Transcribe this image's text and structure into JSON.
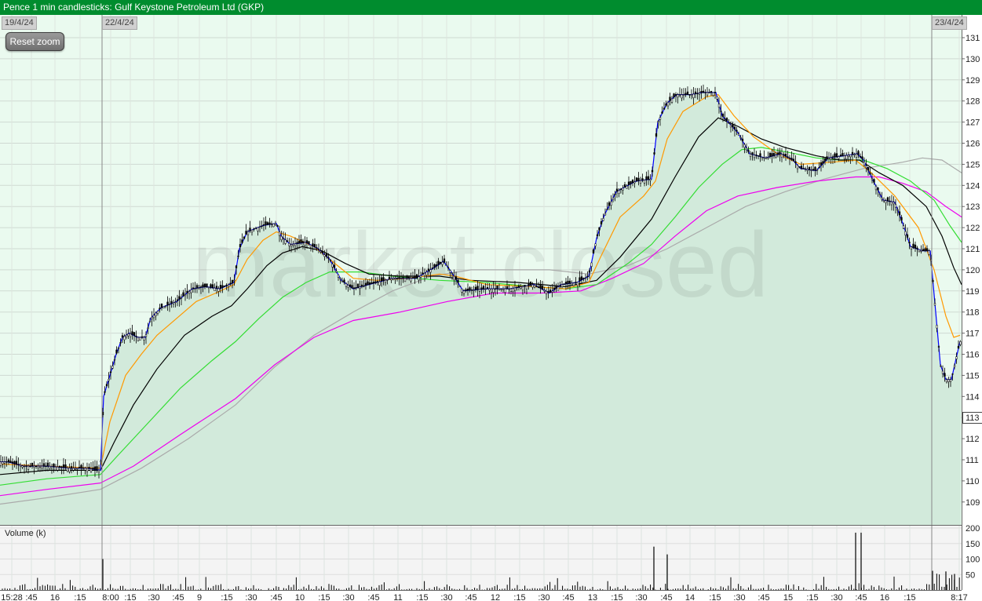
{
  "title": "Pence 1 min candlesticks: Gulf Keystone Petroleum Ltd (GKP)",
  "reset_zoom_label": "Reset zoom",
  "watermark": "market closed",
  "date_flags": [
    "19/4/24",
    "22/4/24",
    "23/4/24"
  ],
  "volume_label": "Volume (k)",
  "last_price_label": "113",
  "colors": {
    "title_bar": "#008c2e",
    "plot_bg": "#eafaef",
    "area_fill": "#d2eadb",
    "candles": "#000000",
    "ma_fast": "#0000ff",
    "ma_orange": "#ff9900",
    "ma_black": "#000000",
    "ma_green": "#33dd33",
    "ma_magenta": "#ee00ee",
    "ma_grey": "#aaaaaa"
  },
  "chart_data": {
    "type": "line",
    "title": "Pence 1 min candlesticks: Gulf Keystone Petroleum Ltd (GKP)",
    "y_axis": {
      "ticks": [
        109,
        110,
        111,
        112,
        113,
        114,
        115,
        116,
        117,
        118,
        119,
        120,
        121,
        122,
        123,
        124,
        125,
        126,
        127,
        128,
        129,
        130,
        131
      ],
      "range": [
        108.2,
        131.3
      ]
    },
    "volume_axis": {
      "ticks": [
        50,
        100,
        150,
        200
      ],
      "range": [
        0,
        210
      ]
    },
    "x_ticks": [
      "15:28",
      ":45",
      "16",
      ":15",
      "8:00",
      ":15",
      ":30",
      ":45",
      "9",
      ":15",
      ":30",
      ":45",
      "10",
      ":15",
      ":30",
      ":45",
      "11",
      ":15",
      ":30",
      ":45",
      "12",
      ":15",
      ":30",
      ":45",
      "13",
      ":15",
      ":30",
      ":45",
      "14",
      ":15",
      ":30",
      ":45",
      "15",
      ":15",
      ":30",
      ":45",
      "16",
      ":15",
      "8:17"
    ],
    "series": [
      {
        "name": "price",
        "color": "#0000ff",
        "points": [
          [
            0,
            110.9
          ],
          [
            10,
            110.9
          ],
          [
            30,
            110.7
          ],
          [
            60,
            110.7
          ],
          [
            90,
            110.6
          ],
          [
            110,
            110.6
          ],
          [
            128,
            110.5
          ],
          [
            132,
            114
          ],
          [
            140,
            115
          ],
          [
            148,
            116
          ],
          [
            156,
            116.8
          ],
          [
            165,
            117
          ],
          [
            175,
            116.8
          ],
          [
            185,
            116.8
          ],
          [
            192,
            117.7
          ],
          [
            205,
            118.2
          ],
          [
            225,
            118.5
          ],
          [
            245,
            119.1
          ],
          [
            262,
            119.2
          ],
          [
            280,
            119.1
          ],
          [
            298,
            119.4
          ],
          [
            305,
            121
          ],
          [
            315,
            121.8
          ],
          [
            335,
            122.1
          ],
          [
            352,
            122.2
          ],
          [
            358,
            121.6
          ],
          [
            370,
            121.2
          ],
          [
            390,
            121.3
          ],
          [
            405,
            121
          ],
          [
            420,
            120.5
          ],
          [
            435,
            119.5
          ],
          [
            450,
            119.1
          ],
          [
            470,
            119.3
          ],
          [
            500,
            119.6
          ],
          [
            530,
            119.6
          ],
          [
            553,
            120.1
          ],
          [
            565,
            120.4
          ],
          [
            575,
            119.9
          ],
          [
            590,
            119
          ],
          [
            620,
            119.1
          ],
          [
            650,
            119.1
          ],
          [
            680,
            119.3
          ],
          [
            700,
            118.9
          ],
          [
            715,
            119.3
          ],
          [
            735,
            119.4
          ],
          [
            750,
            119.7
          ],
          [
            760,
            121.5
          ],
          [
            770,
            122.6
          ],
          [
            785,
            123.7
          ],
          [
            810,
            124.2
          ],
          [
            830,
            124.3
          ],
          [
            838,
            127
          ],
          [
            850,
            127.9
          ],
          [
            862,
            128.3
          ],
          [
            880,
            128.3
          ],
          [
            895,
            128.4
          ],
          [
            912,
            128.4
          ],
          [
            920,
            127.3
          ],
          [
            940,
            126.5
          ],
          [
            955,
            125.5
          ],
          [
            975,
            125.3
          ],
          [
            995,
            125.5
          ],
          [
            1010,
            125.2
          ],
          [
            1020,
            124.8
          ],
          [
            1040,
            124.7
          ],
          [
            1055,
            125.3
          ],
          [
            1075,
            125.4
          ],
          [
            1092,
            125.5
          ],
          [
            1100,
            125.2
          ],
          [
            1110,
            124.4
          ],
          [
            1125,
            123.3
          ],
          [
            1140,
            123.2
          ],
          [
            1150,
            122.2
          ],
          [
            1160,
            121.1
          ],
          [
            1175,
            120.9
          ],
          [
            1185,
            120.9
          ],
          [
            1192,
            118
          ],
          [
            1198,
            115.5
          ],
          [
            1205,
            114.8
          ],
          [
            1212,
            114.8
          ],
          [
            1218,
            115.8
          ],
          [
            1223,
            116.6
          ]
        ]
      },
      {
        "name": "ma_orange",
        "color": "#ff9900",
        "points": [
          [
            0,
            110.8
          ],
          [
            60,
            110.7
          ],
          [
            128,
            110.6
          ],
          [
            140,
            112.8
          ],
          [
            160,
            115
          ],
          [
            180,
            116
          ],
          [
            200,
            116.9
          ],
          [
            225,
            117.7
          ],
          [
            250,
            118.5
          ],
          [
            275,
            118.9
          ],
          [
            298,
            119.3
          ],
          [
            315,
            120.5
          ],
          [
            335,
            121.4
          ],
          [
            352,
            121.8
          ],
          [
            370,
            121.6
          ],
          [
            400,
            121.1
          ],
          [
            430,
            120.2
          ],
          [
            450,
            119.6
          ],
          [
            480,
            119.5
          ],
          [
            520,
            119.6
          ],
          [
            560,
            119.8
          ],
          [
            580,
            119.7
          ],
          [
            620,
            119.3
          ],
          [
            680,
            119.2
          ],
          [
            720,
            119.1
          ],
          [
            750,
            119.4
          ],
          [
            765,
            120.6
          ],
          [
            790,
            122.5
          ],
          [
            820,
            123.5
          ],
          [
            835,
            124.2
          ],
          [
            850,
            126.2
          ],
          [
            870,
            127.5
          ],
          [
            900,
            128.2
          ],
          [
            915,
            128.3
          ],
          [
            935,
            127.3
          ],
          [
            960,
            126.3
          ],
          [
            990,
            125.5
          ],
          [
            1020,
            125
          ],
          [
            1060,
            125.1
          ],
          [
            1090,
            125.2
          ],
          [
            1110,
            124.6
          ],
          [
            1140,
            123.5
          ],
          [
            1170,
            122
          ],
          [
            1190,
            120
          ],
          [
            1205,
            117.8
          ],
          [
            1215,
            116.8
          ],
          [
            1223,
            116.9
          ]
        ]
      },
      {
        "name": "ma_black",
        "color": "#000000",
        "points": [
          [
            0,
            110.3
          ],
          [
            60,
            110.5
          ],
          [
            128,
            110.5
          ],
          [
            145,
            111.8
          ],
          [
            170,
            113.6
          ],
          [
            200,
            115.3
          ],
          [
            235,
            116.9
          ],
          [
            270,
            117.8
          ],
          [
            295,
            118.3
          ],
          [
            315,
            119.1
          ],
          [
            340,
            120.2
          ],
          [
            360,
            120.8
          ],
          [
            385,
            121.1
          ],
          [
            410,
            120.9
          ],
          [
            440,
            120.3
          ],
          [
            470,
            119.8
          ],
          [
            510,
            119.7
          ],
          [
            560,
            119.7
          ],
          [
            600,
            119.5
          ],
          [
            660,
            119.4
          ],
          [
            720,
            119.2
          ],
          [
            760,
            119.5
          ],
          [
            790,
            120.6
          ],
          [
            830,
            122.4
          ],
          [
            860,
            124.4
          ],
          [
            890,
            126.3
          ],
          [
            915,
            127.2
          ],
          [
            940,
            126.8
          ],
          [
            970,
            126.2
          ],
          [
            1000,
            125.8
          ],
          [
            1040,
            125.4
          ],
          [
            1070,
            125.2
          ],
          [
            1095,
            125.2
          ],
          [
            1120,
            124.6
          ],
          [
            1150,
            124
          ],
          [
            1180,
            123
          ],
          [
            1200,
            121.6
          ],
          [
            1215,
            120.1
          ],
          [
            1225,
            119.3
          ]
        ]
      },
      {
        "name": "ma_green",
        "color": "#33dd33",
        "points": [
          [
            0,
            109.8
          ],
          [
            60,
            110.1
          ],
          [
            128,
            110.3
          ],
          [
            150,
            111.2
          ],
          [
            190,
            112.8
          ],
          [
            230,
            114.4
          ],
          [
            270,
            115.7
          ],
          [
            300,
            116.6
          ],
          [
            330,
            117.7
          ],
          [
            360,
            118.7
          ],
          [
            390,
            119.4
          ],
          [
            420,
            119.9
          ],
          [
            460,
            119.9
          ],
          [
            500,
            119.7
          ],
          [
            560,
            119.5
          ],
          [
            620,
            119.4
          ],
          [
            680,
            119.2
          ],
          [
            720,
            119.1
          ],
          [
            760,
            119.3
          ],
          [
            800,
            120.3
          ],
          [
            830,
            121.2
          ],
          [
            860,
            122.5
          ],
          [
            890,
            123.9
          ],
          [
            920,
            125
          ],
          [
            945,
            125.7
          ],
          [
            970,
            125.8
          ],
          [
            1000,
            125.6
          ],
          [
            1040,
            125.3
          ],
          [
            1070,
            125.2
          ],
          [
            1100,
            125.2
          ],
          [
            1130,
            124.8
          ],
          [
            1160,
            124.2
          ],
          [
            1190,
            123.3
          ],
          [
            1210,
            122.1
          ],
          [
            1225,
            121.3
          ]
        ]
      },
      {
        "name": "ma_magenta",
        "color": "#ee00ee",
        "points": [
          [
            0,
            109.3
          ],
          [
            60,
            109.6
          ],
          [
            128,
            109.9
          ],
          [
            170,
            110.7
          ],
          [
            230,
            112.2
          ],
          [
            300,
            113.9
          ],
          [
            350,
            115.5
          ],
          [
            400,
            116.8
          ],
          [
            450,
            117.6
          ],
          [
            510,
            118
          ],
          [
            570,
            118.5
          ],
          [
            630,
            118.9
          ],
          [
            690,
            118.9
          ],
          [
            740,
            119
          ],
          [
            780,
            119.6
          ],
          [
            820,
            120.3
          ],
          [
            860,
            121.6
          ],
          [
            900,
            122.8
          ],
          [
            940,
            123.5
          ],
          [
            990,
            123.9
          ],
          [
            1040,
            124.2
          ],
          [
            1090,
            124.4
          ],
          [
            1120,
            124.4
          ],
          [
            1150,
            124.1
          ],
          [
            1180,
            123.7
          ],
          [
            1205,
            123
          ],
          [
            1225,
            122.5
          ]
        ]
      },
      {
        "name": "ma_grey",
        "color": "#aaaaaa",
        "points": [
          [
            0,
            108.9
          ],
          [
            60,
            109.2
          ],
          [
            128,
            109.6
          ],
          [
            180,
            110.6
          ],
          [
            240,
            112
          ],
          [
            300,
            113.6
          ],
          [
            350,
            115.4
          ],
          [
            400,
            116.9
          ],
          [
            450,
            118
          ],
          [
            500,
            119
          ],
          [
            550,
            119.7
          ],
          [
            600,
            120
          ],
          [
            650,
            120
          ],
          [
            700,
            120
          ],
          [
            750,
            119.8
          ],
          [
            800,
            120.2
          ],
          [
            850,
            121
          ],
          [
            900,
            122
          ],
          [
            950,
            123
          ],
          [
            1000,
            123.7
          ],
          [
            1050,
            124.3
          ],
          [
            1100,
            124.8
          ],
          [
            1150,
            125.1
          ],
          [
            1175,
            125.3
          ],
          [
            1200,
            125.2
          ],
          [
            1225,
            124.6
          ]
        ]
      }
    ]
  }
}
